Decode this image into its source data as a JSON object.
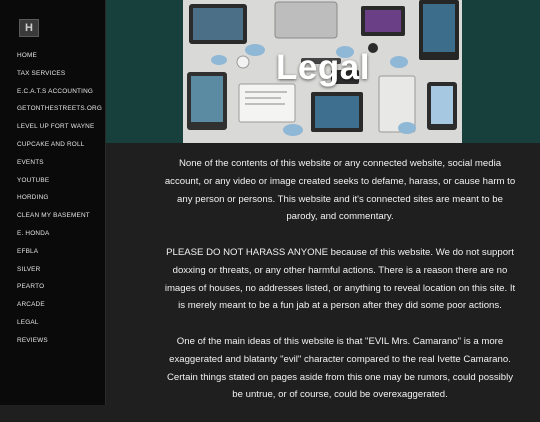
{
  "site": {
    "logo_letter": "H"
  },
  "sidebar": {
    "items": [
      {
        "label": "HOME"
      },
      {
        "label": "TAX SERVICES"
      },
      {
        "label": "E.C.A.T.S ACCOUNTING"
      },
      {
        "label": "GETONTHESTREETS.ORG"
      },
      {
        "label": "LEVEL UP FORT WAYNE"
      },
      {
        "label": "CUPCAKE AND ROLL"
      },
      {
        "label": "EVENTS"
      },
      {
        "label": "YOUTUBE"
      },
      {
        "label": "HORDING"
      },
      {
        "label": "CLEAN MY BASEMENT"
      },
      {
        "label": "E. HONDA"
      },
      {
        "label": "EFBLA"
      },
      {
        "label": "SILVER"
      },
      {
        "label": "PEARTO"
      },
      {
        "label": "ARCADE"
      },
      {
        "label": "LEGAL"
      },
      {
        "label": "REVIEWS"
      }
    ]
  },
  "hero": {
    "title": "Legal"
  },
  "content": {
    "paragraphs": [
      "None of the contents of this website or any connected website, social media account, or any video or image created seeks to defame, harass, or cause harm to any person or persons. This website and it's connected sites are meant to be parody, and commentary.",
      "PLEASE DO NOT HARASS ANYONE because of this website. We do not support doxxing or threats, or any other harmful actions. There is a reason there are no images of houses, no addresses listed, or anything to reveal location on this site. It is merely meant to be a fun jab at a person after they did some poor actions.",
      "One of the main ideas of this website is that \"EVIL Mrs. Camarano\" is a more exaggerated and blatanty \"evil\" character compared to the real Ivette Camarano. Certain things stated on pages aside from this one  may be rumors, could possibly be untrue, or of course,  could be overexaggerated."
    ]
  }
}
